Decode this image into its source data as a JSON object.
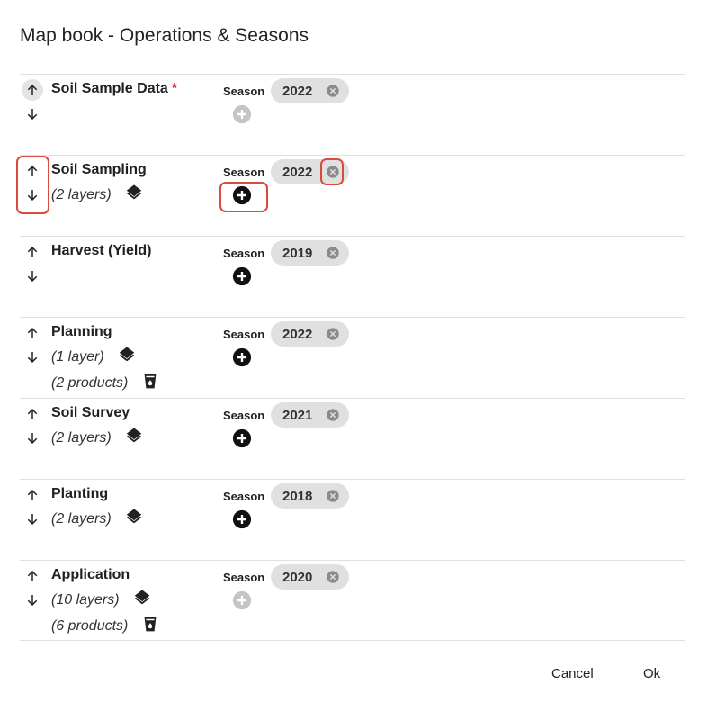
{
  "dialog": {
    "title": "Map book - Operations & Seasons",
    "cancel_label": "Cancel",
    "ok_label": "Ok"
  },
  "season_label": "Season",
  "operations": [
    {
      "name": "Soil Sample Data",
      "required": "*",
      "layers": "",
      "products": "",
      "season": "2022",
      "add_enabled": false,
      "up_active": true
    },
    {
      "name": "Soil Sampling",
      "required": "",
      "layers": "(2 layers)",
      "products": "",
      "season": "2022",
      "add_enabled": true,
      "up_active": false
    },
    {
      "name": "Harvest (Yield)",
      "required": "",
      "layers": "",
      "products": "",
      "season": "2019",
      "add_enabled": true,
      "up_active": false
    },
    {
      "name": "Planning",
      "required": "",
      "layers": "(1 layer)",
      "products": "(2 products)",
      "season": "2022",
      "add_enabled": true,
      "up_active": false
    },
    {
      "name": "Soil Survey",
      "required": "",
      "layers": "(2 layers)",
      "products": "",
      "season": "2021",
      "add_enabled": true,
      "up_active": false
    },
    {
      "name": "Planting",
      "required": "",
      "layers": "(2 layers)",
      "products": "",
      "season": "2018",
      "add_enabled": true,
      "up_active": false
    },
    {
      "name": "Application",
      "required": "",
      "layers": "(10 layers)",
      "products": "(6 products)",
      "season": "2020",
      "add_enabled": false,
      "up_active": false
    }
  ],
  "icons": {
    "up": "arrow-up-icon",
    "down": "arrow-down-icon",
    "layers": "layers-icon",
    "products": "product-bucket-icon",
    "remove": "cancel-circle-icon",
    "add": "add-circle-icon"
  },
  "colors": {
    "add_enabled": "#111111",
    "add_disabled": "#c4c4c4",
    "chip_bg": "#e0e0e0",
    "chip_close": "#8a8a8a",
    "highlight": "#d94b3c",
    "required": "#c62828"
  }
}
